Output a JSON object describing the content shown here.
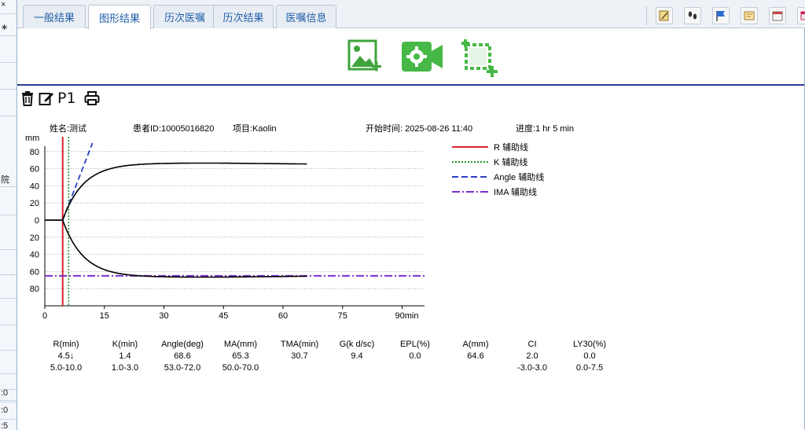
{
  "left_strip": {
    "rows": [
      "×",
      "∗",
      "",
      "",
      "",
      "院",
      "",
      "",
      "",
      "",
      "",
      "",
      "",
      "",
      "",
      ":0",
      ":0",
      ":5"
    ]
  },
  "tabs": [
    {
      "label": "一般结果",
      "active": false
    },
    {
      "label": "图形结果",
      "active": true
    },
    {
      "label": "历次医嘱",
      "active": false
    },
    {
      "label": "历次结果",
      "active": false
    },
    {
      "label": "医嘱信息",
      "active": false
    }
  ],
  "toolbar_icons": [
    "edit-note-icon",
    "footprints-icon",
    "flag-icon",
    "report-icon",
    "calendar-icon",
    "window-icon"
  ],
  "actions": [
    "add-image-icon",
    "video-settings-icon",
    "crop-add-icon"
  ],
  "mini_toolbar": {
    "page_label": "P1"
  },
  "chart_info": {
    "name": "姓名:测试",
    "patient_id": "患者ID:10005016820",
    "project": "项目:Kaolin",
    "start_time": "开始时间: 2025-08-26 11:40",
    "progress": "进度:1 hr  5 min"
  },
  "chart_data": {
    "type": "line",
    "title": "",
    "xlabel": "min",
    "ylabel": "mm",
    "x_ticks": [
      "0",
      "15",
      "30",
      "45",
      "60",
      "75",
      "90min"
    ],
    "y_ticks": [
      "80",
      "60",
      "40",
      "20",
      "0",
      "20",
      "40",
      "60",
      "80"
    ],
    "xlim": [
      0,
      95
    ],
    "ylim": [
      -100,
      90
    ],
    "grid": true,
    "legend_position": "right",
    "r_min": 4.5,
    "k_min": 6.0,
    "ma_mm": 65.3,
    "trace_end_min": 66,
    "angle_line": {
      "x": [
        4.5,
        12
      ],
      "y": [
        0,
        90
      ]
    },
    "ima_line_y": -65,
    "legend": [
      {
        "label": "R 辅助线",
        "color": "#d8232a",
        "style": "solid"
      },
      {
        "label": "K 辅助线",
        "color": "#1f9a2a",
        "style": "dotted"
      },
      {
        "label": "Angle 辅助线",
        "color": "#2b3fbd",
        "style": "dashed"
      },
      {
        "label": "IMA 辅助线",
        "color": "#7a2fd0",
        "style": "dashdot"
      }
    ],
    "colors": {
      "trace": "#000000",
      "grid": "#9a9a9a"
    }
  },
  "results": {
    "headers": [
      "R(min)",
      "K(min)",
      "Angle(deg)",
      "MA(mm)",
      "TMA(min)",
      "G(k d/sc)",
      "EPL(%)",
      "A(mm)",
      "CI",
      "LY30(%)"
    ],
    "values": [
      "4.5↓",
      "1.4",
      "68.6",
      "65.3",
      "30.7",
      "9.4",
      "0.0",
      "64.6",
      "2.0",
      "0.0"
    ],
    "ranges": [
      "5.0-10.0",
      "1.0-3.0",
      "53.0-72.0",
      "50.0-70.0",
      "",
      "",
      "",
      "",
      "-3.0-3.0",
      "0.0-7.5"
    ]
  }
}
